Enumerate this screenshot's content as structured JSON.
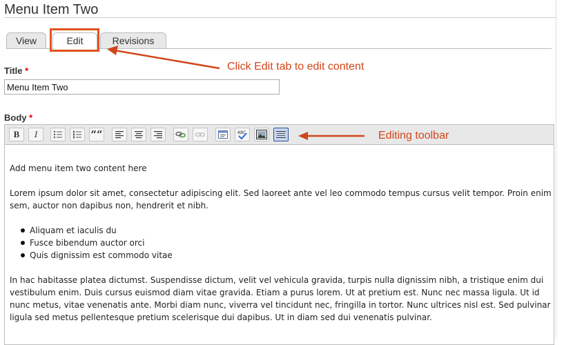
{
  "page": {
    "title": "Menu Item Two"
  },
  "tabs": [
    {
      "label": "View",
      "active": false
    },
    {
      "label": "Edit",
      "active": true
    },
    {
      "label": "Revisions",
      "active": false
    }
  ],
  "fields": {
    "title": {
      "label": "Title",
      "required_mark": "*",
      "value": "Menu Item Two"
    },
    "body": {
      "label": "Body",
      "required_mark": "*"
    }
  },
  "toolbar": {
    "buttons": [
      "bold-button",
      "italic-button",
      "bulleted-list-button",
      "numbered-list-button",
      "blockquote-button",
      "align-left-button",
      "align-center-button",
      "align-right-button",
      "link-button",
      "unlink-button",
      "source-button",
      "spellcheck-button",
      "image-button",
      "show-blocks-button"
    ],
    "bold_label": "B",
    "italic_label": "I",
    "quote_label": "““",
    "active_button": "show-blocks-button"
  },
  "editor": {
    "intro": "Add menu item two content here",
    "para1": "Lorem ipsum dolor sit amet, consectetur adipiscing elit. Sed laoreet ante vel leo commodo tempus cursus velit tempor. Proin enim sem, auctor non dapibus non, hendrerit et nibh.",
    "list": [
      "Aliquam et iaculis du",
      "Fusce bibendum auctor orci",
      "Quis dignissim est commodo vitae"
    ],
    "para2": "In hac habitasse platea dictumst. Suspendisse dictum, velit vel vehicula gravida, turpis nulla dignissim nibh, a tristique enim dui vestibulum enim. Duis cursus euismod diam vitae gravida. Etiam a purus lorem. Ut at pretium est. Nunc nec massa ligula. Ut id nunc metus, vitae venenatis ante. Morbi diam nunc, viverra vel tincidunt nec, fringilla in tortor. Nunc ultrices nisl est. Sed pulvinar ligula sed metus pellentesque pretium scelerisque dui dapibus. Ut in diam sed dui venenatis pulvinar."
  },
  "annotations": {
    "edit_tab": "Click Edit tab to edit content",
    "toolbar": "Editing toolbar"
  },
  "colors": {
    "annotation": "#d2451a",
    "required": "#dd0000",
    "active_button": "#c9d6ee"
  }
}
